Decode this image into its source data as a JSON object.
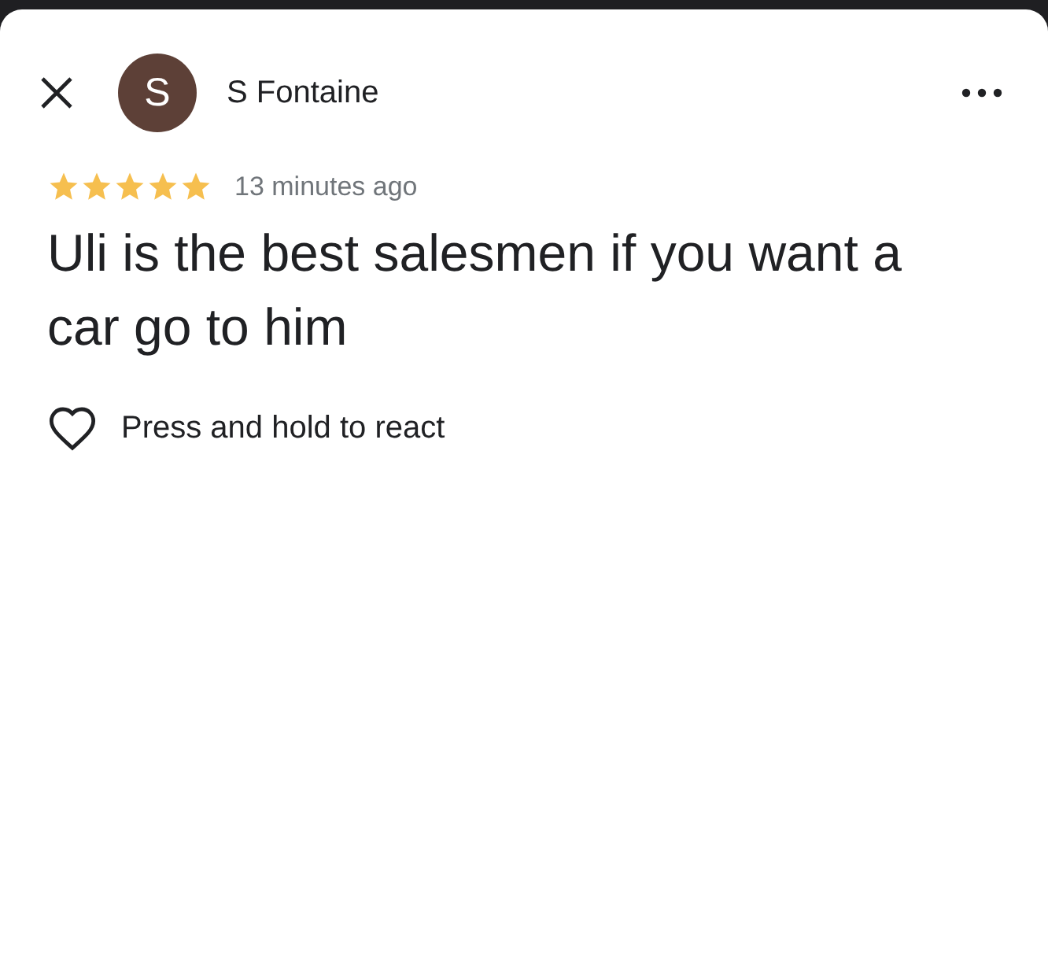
{
  "reviewer": {
    "name": "S Fontaine",
    "avatar_letter": "S"
  },
  "rating": {
    "stars": 5,
    "time": "13 minutes ago"
  },
  "review": {
    "text": "Uli is the best salesmen if you want a car go to him"
  },
  "reaction": {
    "hint": "Press and hold to react"
  }
}
